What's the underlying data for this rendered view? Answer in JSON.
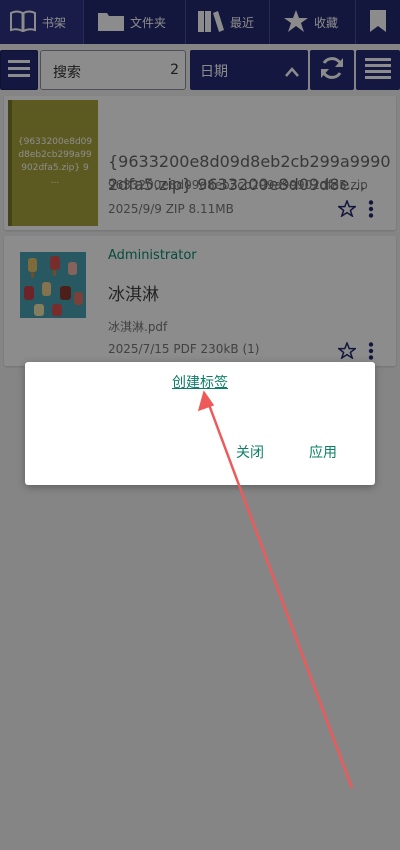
{
  "tabs": [
    {
      "label": "书架",
      "icon": "book-open-icon"
    },
    {
      "label": "文件夹",
      "icon": "folder-icon"
    },
    {
      "label": "最近",
      "icon": "books-icon"
    },
    {
      "label": "收藏",
      "icon": "star-icon"
    },
    {
      "label": "",
      "icon": "bookmark-icon"
    }
  ],
  "toolbar": {
    "search_label": "搜索",
    "search_count": "2",
    "sort_label": "日期"
  },
  "books": [
    {
      "thumb_text": "{9633200e8d09d8eb2cb299a99902dfa5.zip} 9 ...",
      "title": "{9633200e8d09d8eb2cb299a99902dfa5.zip} 9633200e8d09d8e…",
      "subtitle": "9633200e8d09d8eb2cb299a99902dfa5.zip",
      "meta": "2025/9/9  ZIP  8.11MB"
    },
    {
      "author": "Administrator",
      "title": "冰淇淋",
      "file": "冰淇淋.pdf",
      "meta": "2025/7/15  PDF  230kB (1)"
    }
  ],
  "dialog": {
    "link": "创建标签",
    "close": "关闭",
    "apply": "应用"
  },
  "colors": {
    "primary": "#24286f",
    "accent": "#0c7f66",
    "arrow": "#ee5a5a"
  }
}
